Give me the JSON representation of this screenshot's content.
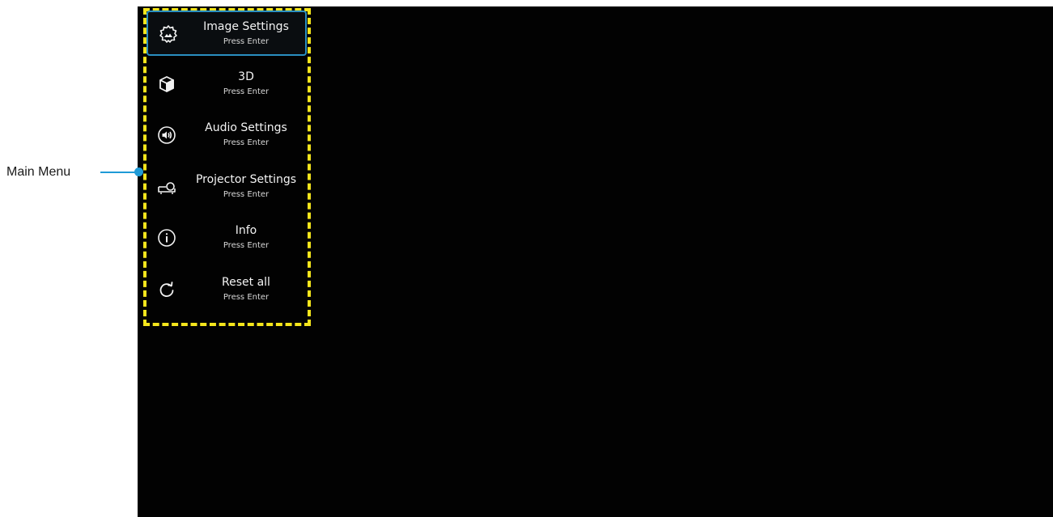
{
  "callout": {
    "label": "Main Menu"
  },
  "menu": {
    "items": [
      {
        "title": "Image Settings",
        "subtitle": "Press Enter",
        "icon": "image-settings-icon",
        "selected": true
      },
      {
        "title": "3D",
        "subtitle": "Press Enter",
        "icon": "cube-icon",
        "selected": false
      },
      {
        "title": "Audio Settings",
        "subtitle": "Press Enter",
        "icon": "speaker-icon",
        "selected": false
      },
      {
        "title": "Projector Settings",
        "subtitle": "Press Enter",
        "icon": "projector-icon",
        "selected": false
      },
      {
        "title": "Info",
        "subtitle": "Press Enter",
        "icon": "info-icon",
        "selected": false
      },
      {
        "title": "Reset all",
        "subtitle": "Press Enter",
        "icon": "reset-icon",
        "selected": false
      }
    ]
  },
  "colors": {
    "screen_background": "#020202",
    "highlight_frame": "#f4e51c",
    "selection_border": "#2a8fc0",
    "callout": "#1f9ad6"
  }
}
